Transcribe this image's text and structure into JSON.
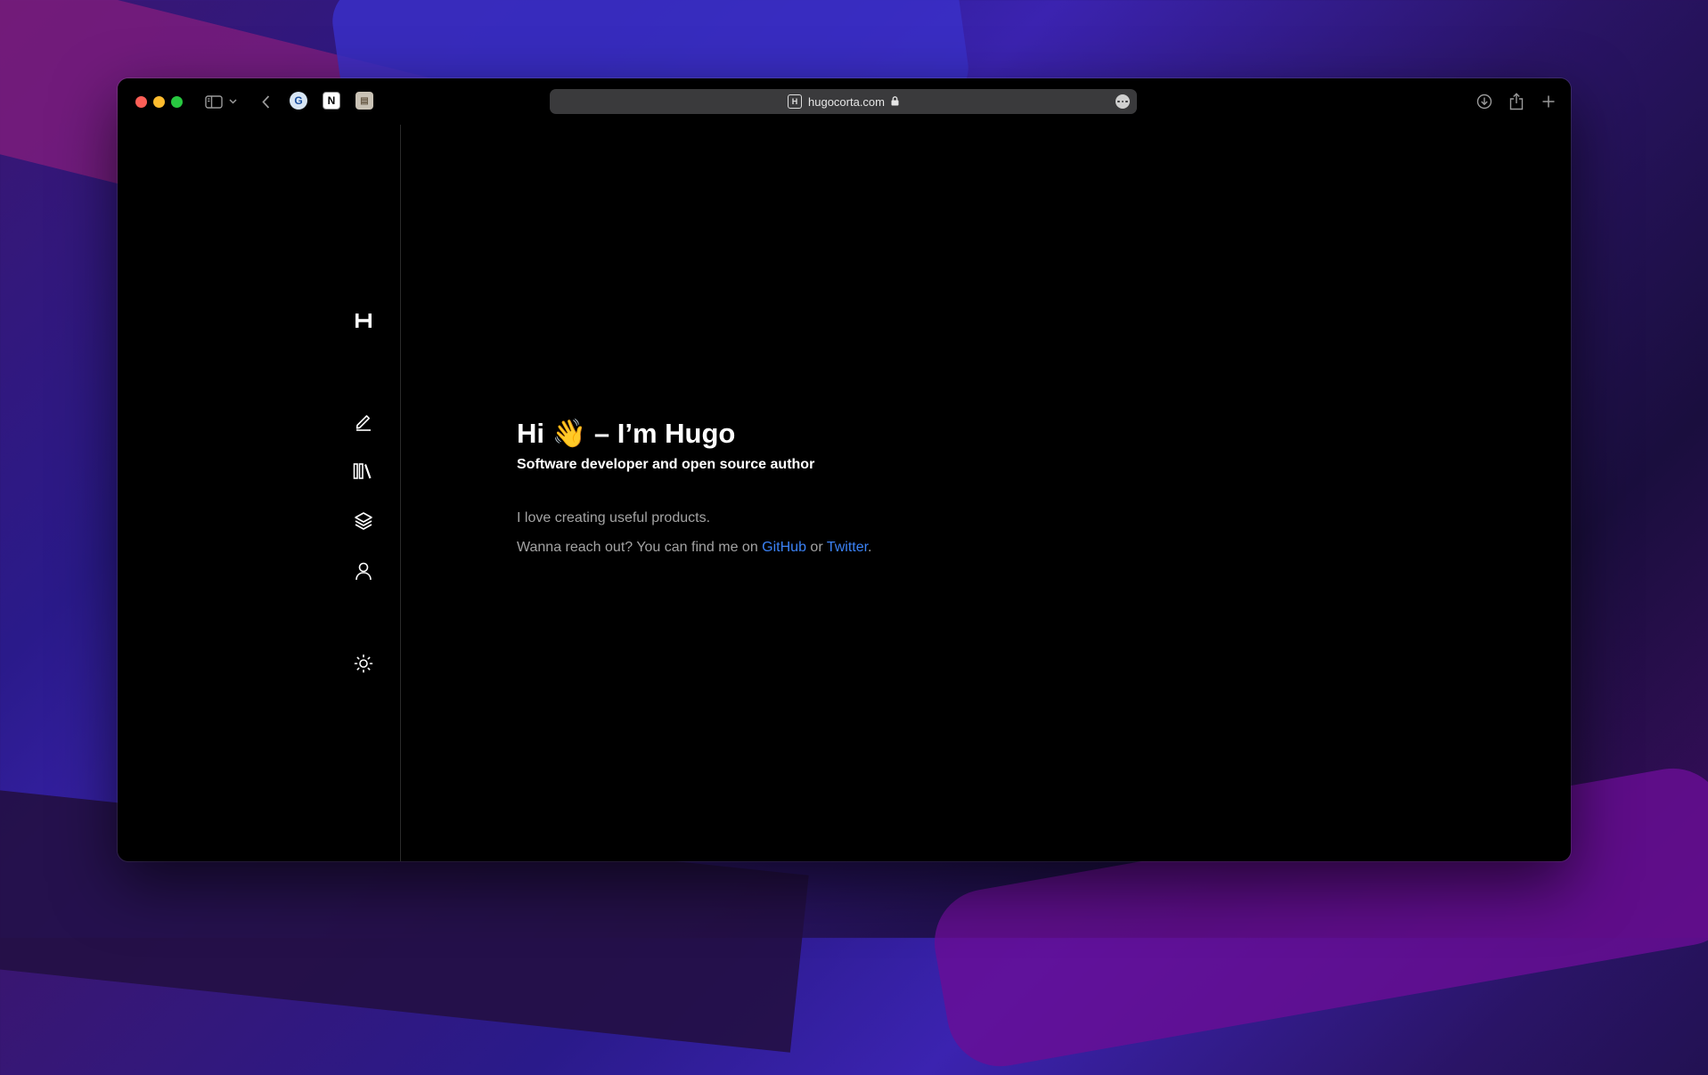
{
  "browser": {
    "url": "hugocorta.com",
    "favorites": [
      {
        "name": "browser-profile-icon",
        "glyph": "G"
      },
      {
        "name": "notion-icon",
        "glyph": "N"
      },
      {
        "name": "contacts-icon",
        "glyph": "▤"
      }
    ],
    "site_favicon": "H"
  },
  "sidebar": {
    "logo": "H",
    "items": [
      {
        "icon": "pencil-icon",
        "label": "Writing"
      },
      {
        "icon": "library-icon",
        "label": "Library"
      },
      {
        "icon": "layers-icon",
        "label": "Projects"
      },
      {
        "icon": "user-icon",
        "label": "About"
      }
    ],
    "theme_toggle_icon": "sun-icon"
  },
  "hero": {
    "title_prefix": "Hi",
    "emoji": "👋",
    "title_suffix": "– I’m Hugo",
    "subtitle": "Software developer and open source author",
    "paragraph1": "I love creating useful products.",
    "paragraph2_prefix": "Wanna reach out? You can find me on",
    "link_github": "GitHub",
    "connector": "or",
    "link_twitter": "Twitter",
    "end": "."
  },
  "colors": {
    "window_bg": "#000000",
    "link": "#3b82f6",
    "muted_text": "#a3a3a3",
    "address_bar": "#3a3a3c"
  }
}
